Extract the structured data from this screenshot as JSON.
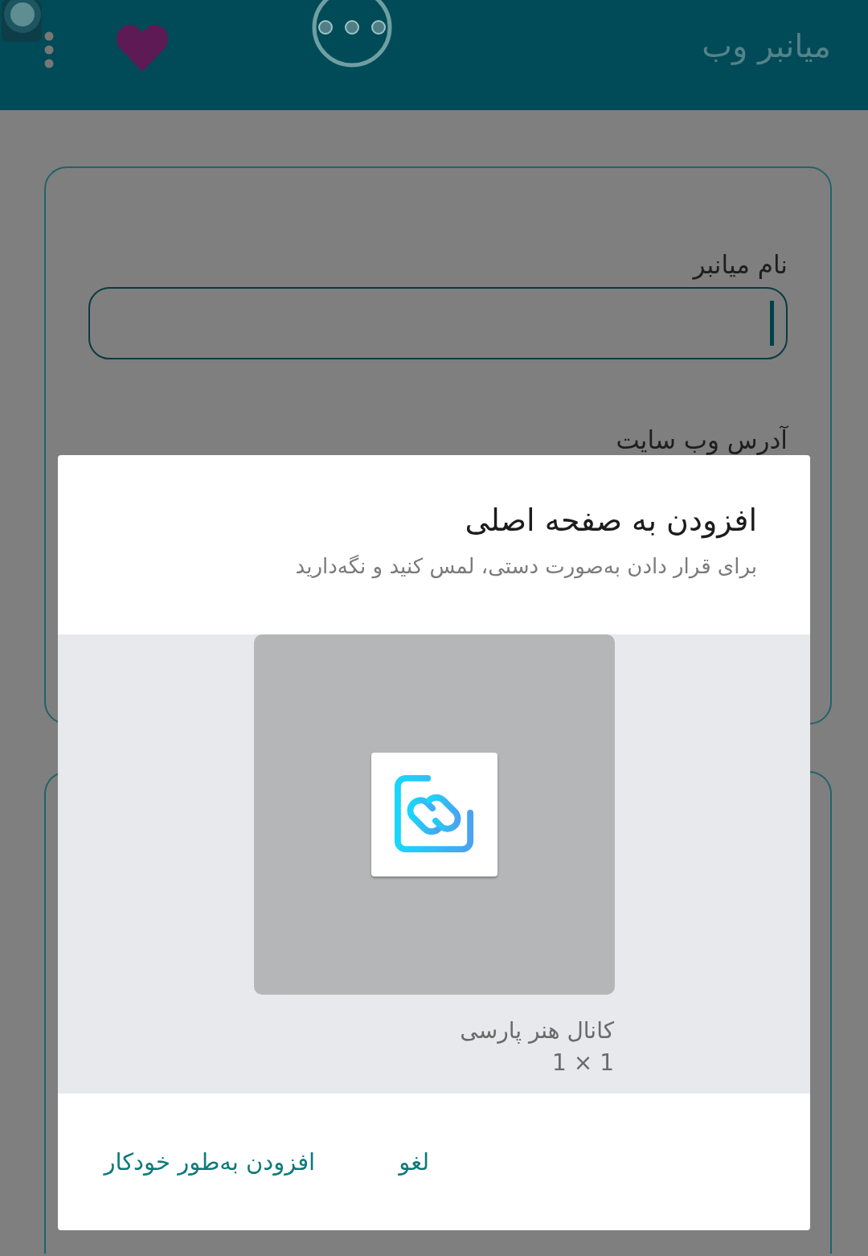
{
  "app_bar": {
    "title": "میانبر وب"
  },
  "form": {
    "fields": [
      {
        "label": "نام میانبر",
        "focused": true
      },
      {
        "label": "آدرس وب سایت"
      }
    ]
  },
  "dialog": {
    "title": "افزودن به صفحه اصلی",
    "subtitle": "برای قرار دادن به‌صورت دستی، لمس کنید و نگه‌دارید",
    "widget": {
      "name": "کانال هنر پارسی",
      "size": "1 × 1"
    },
    "buttons": [
      "لغو",
      "افزودن به‌طور خودکار"
    ]
  }
}
